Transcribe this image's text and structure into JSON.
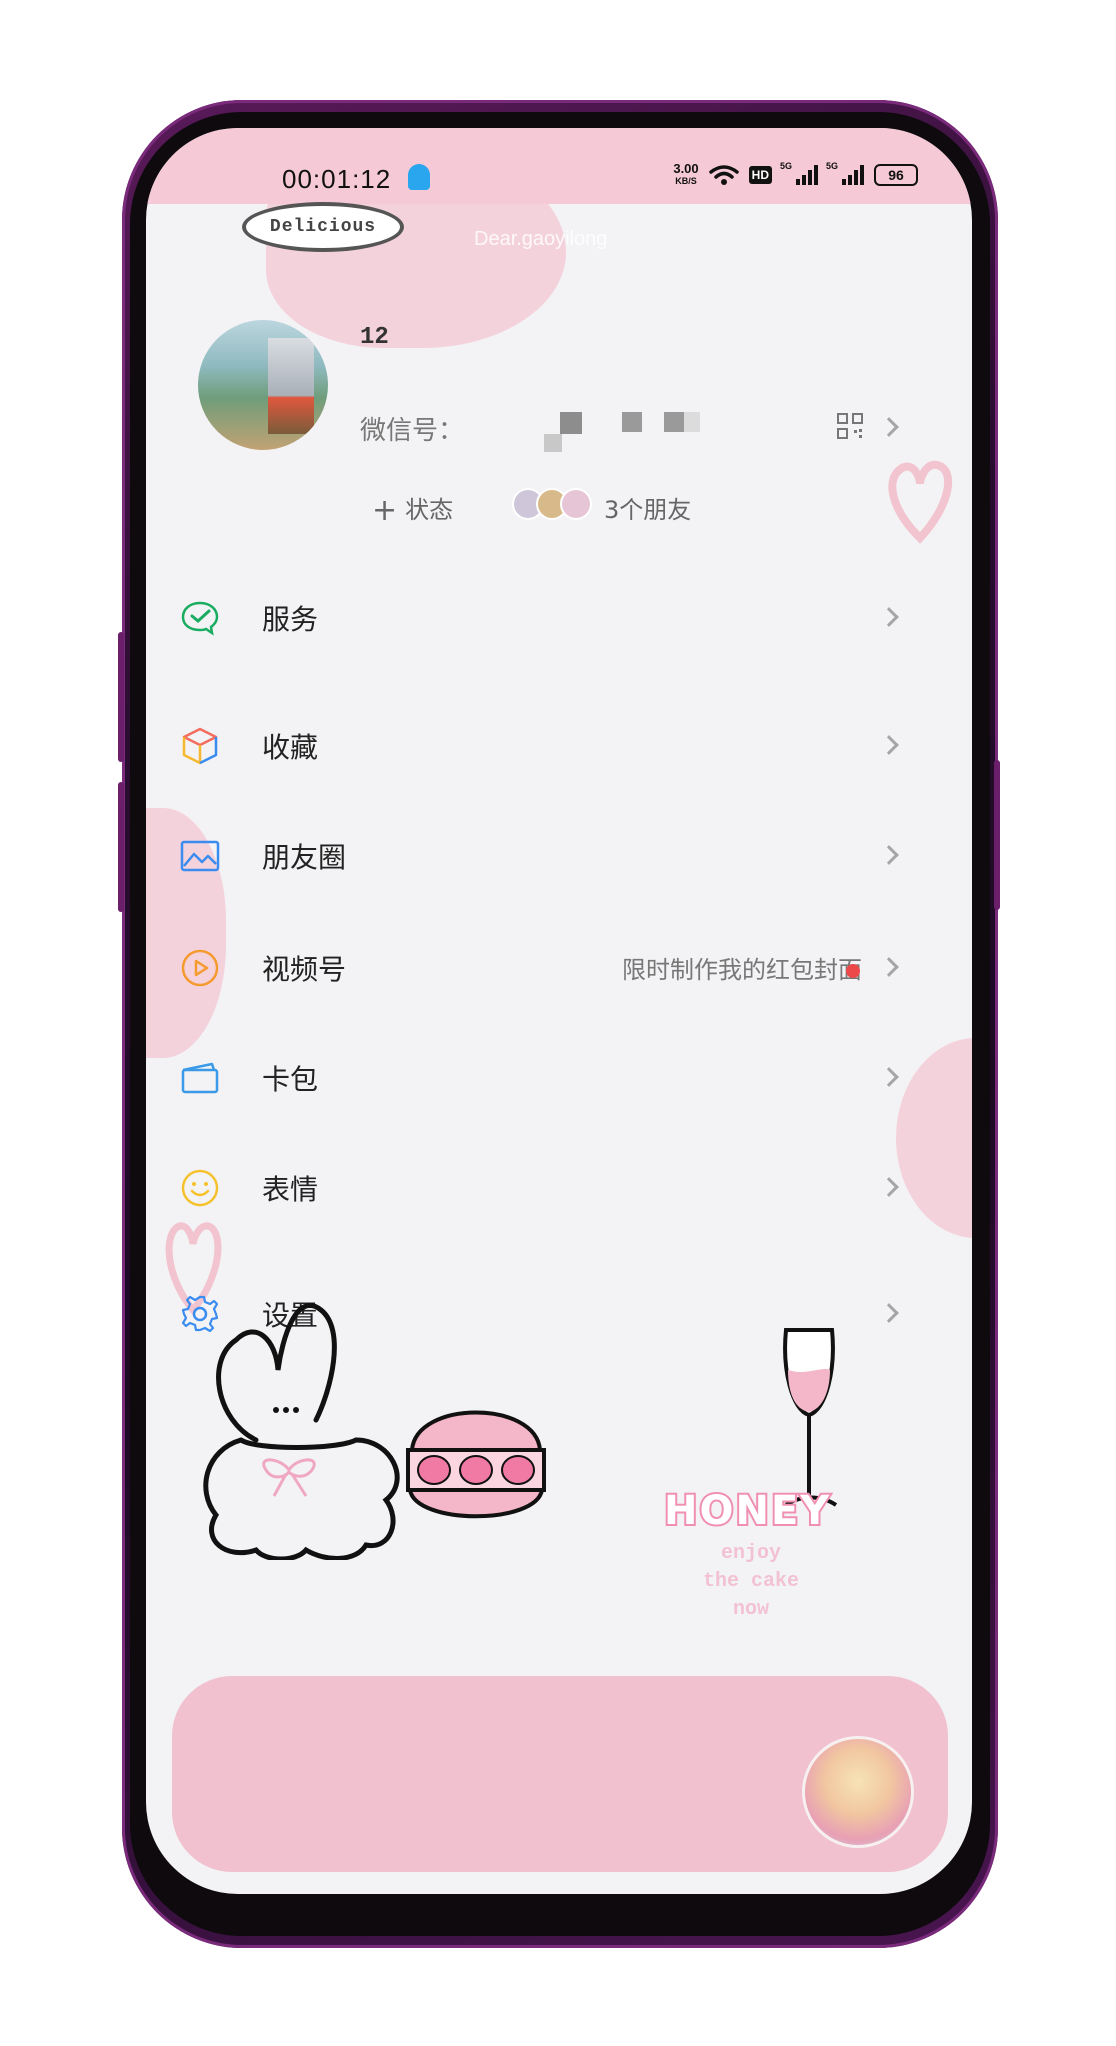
{
  "status_bar": {
    "time": "00:01:12",
    "net_speed": "3.00",
    "net_unit": "KB/S",
    "hd": "HD",
    "sig1_label": "5G",
    "sig2_label": "5G",
    "battery": "96"
  },
  "header": {
    "badge": "Delicious",
    "watermark": "Dear.gaoyilong",
    "nickname": "12",
    "wechat_id_label": "微信号：",
    "status_label": "状态",
    "friends_text": "3个朋友"
  },
  "menu": {
    "items": [
      {
        "label": "服务",
        "icon": "wechat-pay-icon"
      },
      {
        "label": "收藏",
        "icon": "favorites-cube-icon"
      },
      {
        "label": "朋友圈",
        "icon": "moments-image-icon"
      },
      {
        "label": "视频号",
        "icon": "channels-play-icon",
        "extra": "限时制作我的红包封面"
      },
      {
        "label": "卡包",
        "icon": "card-wallet-icon"
      },
      {
        "label": "表情",
        "icon": "sticker-smile-icon"
      },
      {
        "label": "设置",
        "icon": "settings-gear-icon"
      }
    ]
  },
  "illustration": {
    "honey": "HONEY",
    "enjoy_lines": [
      "enjoy",
      "the cake",
      "now"
    ]
  },
  "colors": {
    "accent_pink": "#f1c1cf",
    "status_pink": "#f5c9d6",
    "red_dot": "#ec4a4a"
  }
}
